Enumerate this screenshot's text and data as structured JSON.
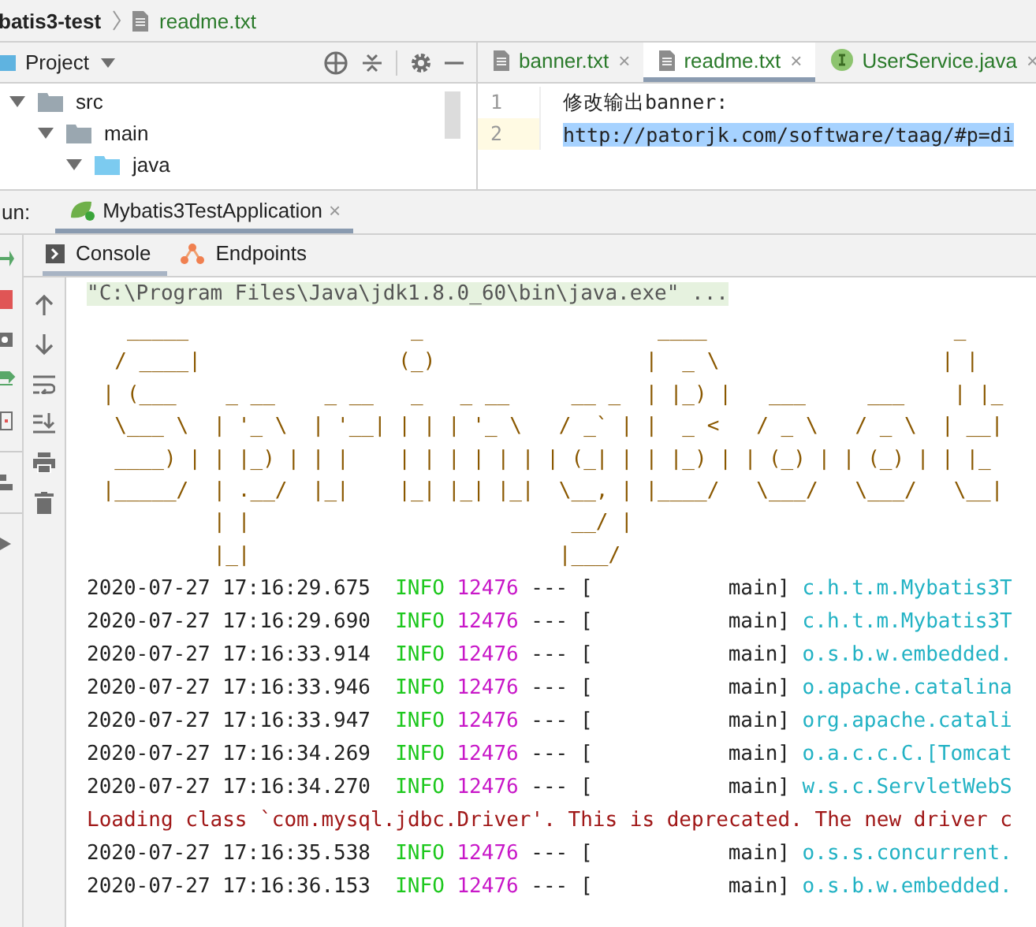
{
  "breadcrumb": {
    "project": "batis3-test",
    "file": "readme.txt"
  },
  "project_panel": {
    "title": "Project",
    "tree": [
      {
        "label": "src",
        "kind": "folder",
        "expanded": true,
        "children": [
          {
            "label": "main",
            "kind": "folder",
            "expanded": true,
            "children": [
              {
                "label": "java",
                "kind": "source",
                "expanded": true
              }
            ]
          }
        ]
      }
    ]
  },
  "editor": {
    "tabs": [
      {
        "label": "banner.txt",
        "kind": "text",
        "selected": false,
        "close": "×"
      },
      {
        "label": "readme.txt",
        "kind": "text",
        "selected": true,
        "close": "×"
      },
      {
        "label": "UserService.java",
        "kind": "interface",
        "selected": false,
        "close": "×"
      }
    ],
    "lines": [
      {
        "number": "1",
        "text": "修改输出banner:",
        "selected": false
      },
      {
        "number": "2",
        "text": "http://patorjk.com/software/taag/#p=di",
        "selected": true
      }
    ]
  },
  "run": {
    "label": "un:",
    "tabs": [
      {
        "label": "Mybatis3TestApplication",
        "selected": true,
        "close": "×"
      }
    ]
  },
  "console": {
    "tabs": [
      {
        "label": "Console",
        "kind": "console",
        "selected": true
      },
      {
        "label": "Endpoints",
        "kind": "endpoints",
        "selected": false
      }
    ],
    "command": "\"C:\\Program Files\\Java\\jdk1.8.0_60\\bin\\java.exe\" ...",
    "banner": [
      "   _____                  _                   ____                    _",
      "  / ____|                (_)                 |  _ \\                  | |",
      " | (___    _ __    _ __   _   _ __     __ _  | |_) |   ___     ___    | |_",
      "  \\___ \\  | '_ \\  | '__| | | | '_ \\   / _` | |  _ <   / _ \\   / _ \\  | __|",
      "  ____) | | |_) | | |    | | | | | | | (_| | | |_) | | (_) | | (_) | | |_",
      " |_____/  | .__/  |_|    |_| |_| |_|  \\__, | |____/   \\___/   \\___/   \\__|",
      "          | |                          __/ |",
      "          |_|                         |___/"
    ],
    "lines": [
      {
        "kind": "log",
        "timestamp": "2020-07-27 17:16:29.675",
        "level": "INFO",
        "pid": "12476",
        "separator": "---",
        "thread": "[           main]",
        "logger": "c.h.t.m.Mybatis3T"
      },
      {
        "kind": "log",
        "timestamp": "2020-07-27 17:16:29.690",
        "level": "INFO",
        "pid": "12476",
        "separator": "---",
        "thread": "[           main]",
        "logger": "c.h.t.m.Mybatis3T"
      },
      {
        "kind": "log",
        "timestamp": "2020-07-27 17:16:33.914",
        "level": "INFO",
        "pid": "12476",
        "separator": "---",
        "thread": "[           main]",
        "logger": "o.s.b.w.embedded."
      },
      {
        "kind": "log",
        "timestamp": "2020-07-27 17:16:33.946",
        "level": "INFO",
        "pid": "12476",
        "separator": "---",
        "thread": "[           main]",
        "logger": "o.apache.catalina"
      },
      {
        "kind": "log",
        "timestamp": "2020-07-27 17:16:33.947",
        "level": "INFO",
        "pid": "12476",
        "separator": "---",
        "thread": "[           main]",
        "logger": "org.apache.catali"
      },
      {
        "kind": "log",
        "timestamp": "2020-07-27 17:16:34.269",
        "level": "INFO",
        "pid": "12476",
        "separator": "---",
        "thread": "[           main]",
        "logger": "o.a.c.c.C.[Tomcat"
      },
      {
        "kind": "log",
        "timestamp": "2020-07-27 17:16:34.270",
        "level": "INFO",
        "pid": "12476",
        "separator": "---",
        "thread": "[           main]",
        "logger": "w.s.c.ServletWebS"
      },
      {
        "kind": "warning",
        "text": "Loading class `com.mysql.jdbc.Driver'. This is deprecated. The new driver c"
      },
      {
        "kind": "log",
        "timestamp": "2020-07-27 17:16:35.538",
        "level": "INFO",
        "pid": "12476",
        "separator": "---",
        "thread": "[           main]",
        "logger": "o.s.s.concurrent."
      },
      {
        "kind": "log",
        "timestamp": "2020-07-27 17:16:36.153",
        "level": "INFO",
        "pid": "12476",
        "separator": "---",
        "thread": "[           main]",
        "logger": "o.s.b.w.embedded."
      }
    ]
  }
}
